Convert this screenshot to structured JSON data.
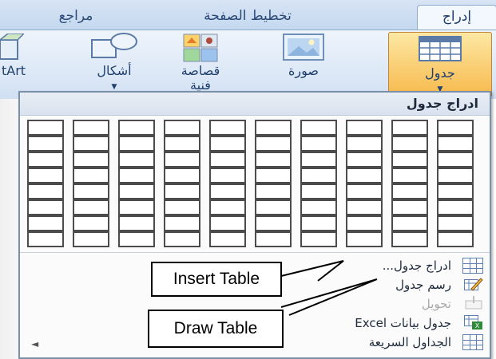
{
  "tabs": [
    {
      "label": "إدراج",
      "active": true
    },
    {
      "label": "تخطيط الصفحة",
      "active": false
    },
    {
      "label": "مراجع",
      "active": false
    }
  ],
  "ribbon": {
    "table": "جدول",
    "picture": "صورة",
    "clipart_line1": "قصاصة",
    "clipart_line2": "فنية",
    "shapes": "أشكال",
    "smartart": "tArt"
  },
  "dropdown": {
    "header": "ادراج جدول",
    "grid_cols": 10,
    "grid_rows": 8,
    "items": [
      {
        "label": "ادراج جدول...",
        "icon": "insert-table-icon",
        "enabled": true
      },
      {
        "label": "رسم جدول",
        "icon": "draw-table-icon",
        "enabled": true
      },
      {
        "label": "تحويل",
        "icon": "convert-table-icon",
        "enabled": false
      },
      {
        "label": "جدول بيانات Excel",
        "icon": "excel-table-icon",
        "enabled": true
      },
      {
        "label": "الجداول السريعة",
        "icon": "quick-tables-icon",
        "enabled": true
      }
    ]
  },
  "callouts": {
    "insert": "Insert Table",
    "draw": "Draw Table"
  }
}
